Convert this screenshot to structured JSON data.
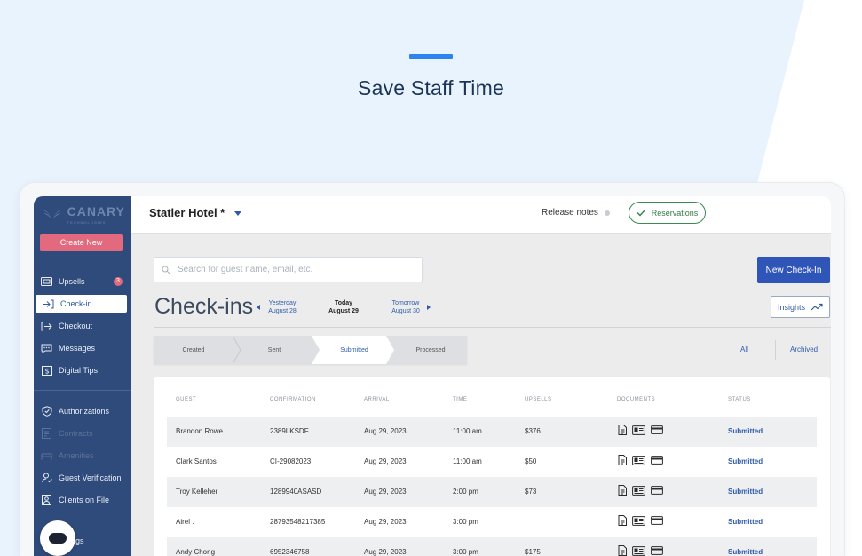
{
  "hero": {
    "title": "Save Staff Time"
  },
  "colors": {
    "accent": "#2d83f2",
    "sidebar": "#2f4b7b",
    "primary": "#2f55b8",
    "create": "#e36a7e",
    "status": "#2f5aa8"
  },
  "sidebar": {
    "logo_text": "CANARY",
    "logo_sub": "TECHNOLOGIES",
    "create_label": "Create New",
    "items": [
      {
        "label": "Upsells",
        "icon": "upsells-icon",
        "badge": "3"
      },
      {
        "label": "Check-in",
        "icon": "checkin-icon",
        "active": true
      },
      {
        "label": "Checkout",
        "icon": "checkout-icon"
      },
      {
        "label": "Messages",
        "icon": "messages-icon"
      },
      {
        "label": "Digital Tips",
        "icon": "dollar-icon"
      },
      {
        "label": "Authorizations",
        "icon": "shield-icon"
      },
      {
        "label": "Contracts",
        "icon": "contract-icon",
        "disabled": true
      },
      {
        "label": "Amenities",
        "icon": "amenities-icon",
        "disabled": true
      },
      {
        "label": "Guest Verification",
        "icon": "guest-verification-icon"
      },
      {
        "label": "Clients on File",
        "icon": "clients-icon"
      },
      {
        "label": "ngs",
        "icon": "settings-icon"
      }
    ]
  },
  "header": {
    "hotel": "Statler Hotel *",
    "release_notes": "Release notes",
    "reservations": "Reservations"
  },
  "search": {
    "placeholder": "Search for guest name, email, etc."
  },
  "actions": {
    "new_checkin": "New Check-In",
    "insights": "Insights"
  },
  "page": {
    "title": "Check-ins",
    "days": {
      "prev": {
        "name": "Yesterday",
        "date": "August 28"
      },
      "current": {
        "name": "Today",
        "date": "August 29"
      },
      "next": {
        "name": "Tomorrow",
        "date": "August 30"
      }
    }
  },
  "stepper": {
    "steps": [
      "Created",
      "Sent",
      "Submitted",
      "Processed"
    ],
    "active": "Submitted"
  },
  "filters": {
    "all": "All",
    "archived": "Archived"
  },
  "table": {
    "columns": [
      "GUEST",
      "CONFIRMATION",
      "ARRIVAL",
      "TIME",
      "UPSELLS",
      "DOCUMENTS",
      "STATUS"
    ],
    "rows": [
      {
        "guest": "Brandon Rowe",
        "confirmation": "2389LKSDF",
        "arrival": "Aug 29, 2023",
        "time": "11:00 am",
        "upsells": "$376",
        "status": "Submitted"
      },
      {
        "guest": "Clark Santos",
        "confirmation": "CI-29082023",
        "arrival": "Aug 29, 2023",
        "time": "11:00 am",
        "upsells": "$50",
        "status": "Submitted"
      },
      {
        "guest": "Troy Kelleher",
        "confirmation": "1289940ASASD",
        "arrival": "Aug 29, 2023",
        "time": "2:00 pm",
        "upsells": "$73",
        "status": "Submitted"
      },
      {
        "guest": "Airel .",
        "confirmation": "28793548217385",
        "arrival": "Aug 29, 2023",
        "time": "3:00 pm",
        "upsells": "",
        "status": "Submitted"
      },
      {
        "guest": "Andy Chong",
        "confirmation": "6952346758",
        "arrival": "Aug 29, 2023",
        "time": "3:00 pm",
        "upsells": "$175",
        "status": "Submitted"
      }
    ]
  }
}
